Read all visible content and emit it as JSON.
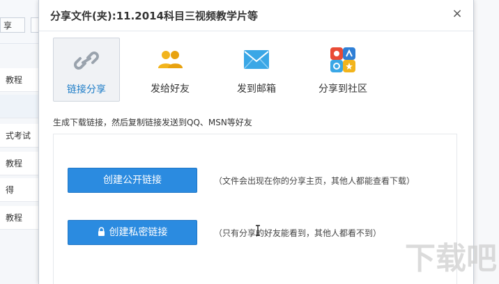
{
  "background": {
    "toolbar_button": "享",
    "rows": [
      "教程",
      "",
      "式考试",
      "教程",
      "得",
      "教程"
    ]
  },
  "dialog": {
    "title": "分享文件(夹):11.2014科目三视频教学片等",
    "close": "×"
  },
  "tabs": [
    {
      "label": "链接分享",
      "icon": "link-icon",
      "active": true
    },
    {
      "label": "发给好友",
      "icon": "friends-icon",
      "active": false
    },
    {
      "label": "发到邮箱",
      "icon": "mail-icon",
      "active": false
    },
    {
      "label": "分享到社区",
      "icon": "community-icon",
      "active": false
    }
  ],
  "hint": "生成下载链接，然后复制链接发送到QQ、MSN等好友",
  "public_link": {
    "label": "创建公开链接",
    "desc": "（文件会出现在你的分享主页，其他人都能查看下载）"
  },
  "private_link": {
    "label": "创建私密链接",
    "desc": "（只有分享的好友能看到，其他人都看不到）"
  },
  "watermark": "下载吧",
  "colors": {
    "accent": "#2b8be0",
    "active_tab_text": "#1c7cc7",
    "friends_icon": "#f2b41c",
    "mail_icon": "#3aa7e6"
  }
}
